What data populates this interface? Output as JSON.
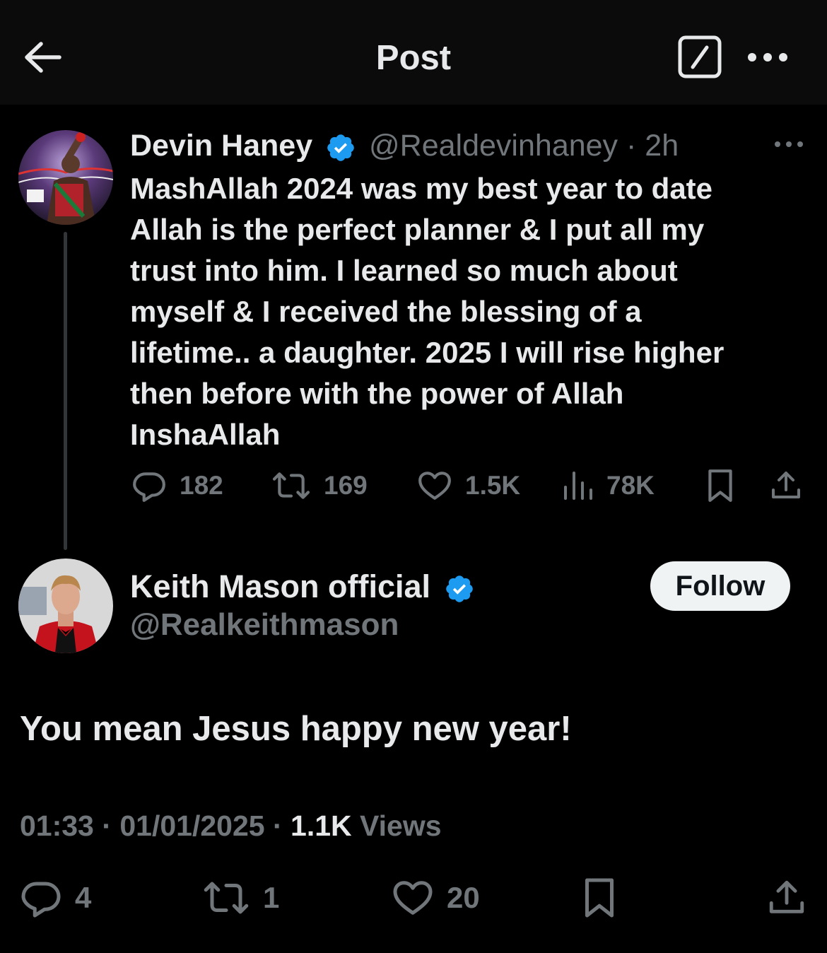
{
  "header": {
    "title": "Post"
  },
  "parent_post": {
    "author_name": "Devin Haney",
    "author_handle": "@Realdevinhaney",
    "separator": "·",
    "time": "2h",
    "text": "MashAllah 2024 was my best year to date\nAllah is the perfect planner & I put all my\ntrust into him.  I learned so much about\nmyself & I received the blessing of a\nlifetime.. a daughter. 2025 I will rise higher\nthen before with the power of Allah\nInshaAllah",
    "stats": {
      "replies": "182",
      "reposts": "169",
      "likes": "1.5K",
      "views": "78K"
    }
  },
  "reply_post": {
    "author_name": "Keith Mason official",
    "author_handle": "@Realkeithmason",
    "follow_label": "Follow",
    "text": "You mean Jesus happy new year!",
    "time": "01:33",
    "date": "01/01/2025",
    "sep1": "·",
    "sep2": "·",
    "views_count": "1.1K",
    "views_label": "Views",
    "stats": {
      "replies": "4",
      "reposts": "1",
      "likes": "20"
    }
  },
  "colors": {
    "background": "#000000",
    "header_bg": "#0b0b0b",
    "text_primary": "#e7e9ea",
    "text_secondary": "#71767b",
    "verified_blue": "#1d9bf0",
    "follow_bg": "#eff3f4"
  },
  "icons": [
    "back-arrow-icon",
    "edit-icon",
    "more-icon",
    "verified-badge-icon",
    "reply-icon",
    "repost-icon",
    "like-icon",
    "views-icon",
    "bookmark-icon",
    "share-icon"
  ]
}
